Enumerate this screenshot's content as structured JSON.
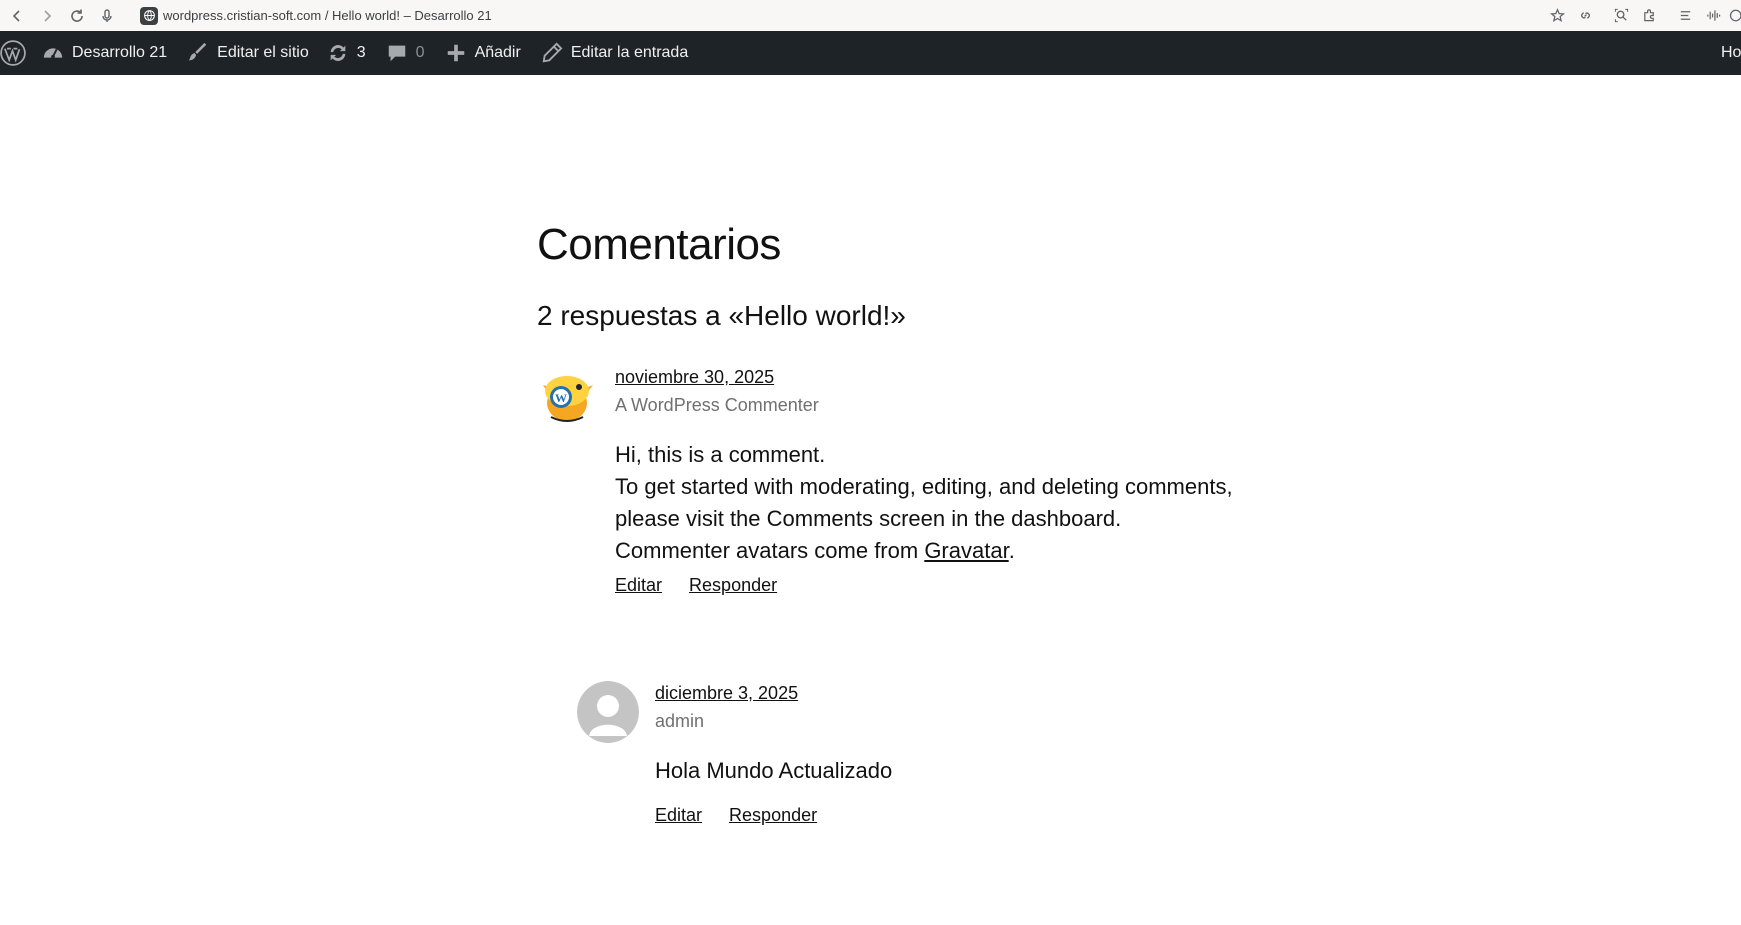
{
  "browser": {
    "url": "wordpress.cristian-soft.com / Hello world! – Desarrollo 21"
  },
  "admin_bar": {
    "site_name": "Desarrollo 21",
    "edit_site": "Editar el sitio",
    "updates_count": "3",
    "comments_count": "0",
    "add_new": "Añadir",
    "edit_post": "Editar la entrada",
    "right_partial": "Ho"
  },
  "page": {
    "heading": "Comentarios",
    "responses_title": "2 respuestas a «Hello world!»"
  },
  "comments": [
    {
      "date": "noviembre 30, 2025",
      "author": "A WordPress Commenter",
      "line1": "Hi, this is a comment.",
      "line2": "To get started with moderating, editing, and deleting comments, please visit the Comments screen in the dashboard.",
      "line3_prefix": "Commenter avatars come from ",
      "line3_link": "Gravatar",
      "line3_suffix": ".",
      "edit": "Editar",
      "reply": "Responder"
    },
    {
      "date": "diciembre 3, 2025",
      "author": "admin",
      "text": "Hola Mundo Actualizado",
      "edit": "Editar",
      "reply": "Responder"
    }
  ]
}
